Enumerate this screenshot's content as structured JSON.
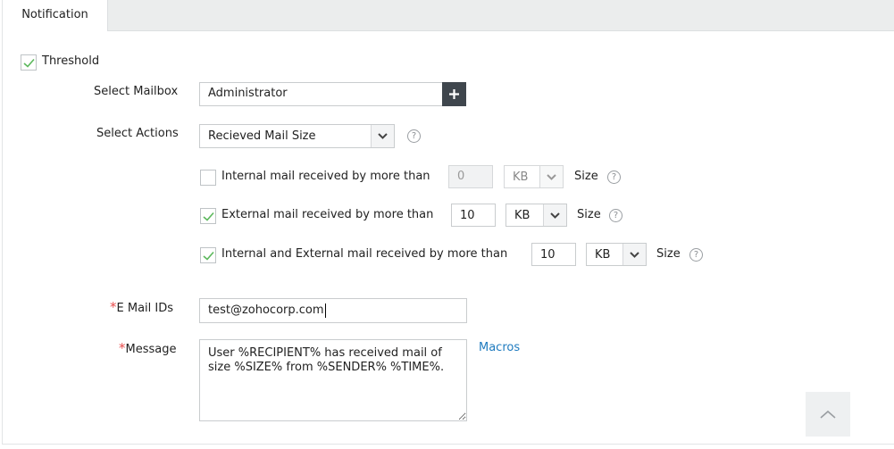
{
  "tabs": [
    {
      "label": "Notification",
      "active": true
    }
  ],
  "threshold": {
    "label": "Threshold",
    "checked": true
  },
  "mailbox": {
    "label": "Select Mailbox",
    "value": "Administrator",
    "add_icon": "plus-icon"
  },
  "actions": {
    "label": "Select Actions",
    "selected": "Recieved Mail Size",
    "help_icon": "question-circle-icon",
    "help_glyph": "?"
  },
  "conditions": [
    {
      "label": "Internal mail received by more than",
      "checked": false,
      "value": "0",
      "unit": "KB",
      "size_label": "Size",
      "disabled": true
    },
    {
      "label": "External mail received by more than",
      "checked": true,
      "value": "10",
      "unit": "KB",
      "size_label": "Size",
      "disabled": false
    },
    {
      "label": "Internal and External mail received by more than",
      "checked": true,
      "value": "10",
      "unit": "KB",
      "size_label": "Size",
      "disabled": false
    }
  ],
  "email": {
    "required_mark": "*",
    "label": "E Mail IDs",
    "value": "test@zohocorp.com"
  },
  "message": {
    "required_mark": "*",
    "label": "Message",
    "value": "User %RECIPIENT% has received mail of size %SIZE% from %SENDER% %TIME%.",
    "macros_link": "Macros"
  },
  "scroll_top": {
    "icon": "chevron-up-icon"
  },
  "colors": {
    "accent_link": "#1f7bbf",
    "check_green": "#5cb85c",
    "required_red": "#e84b4b",
    "add_button_bg": "#3f464d"
  }
}
